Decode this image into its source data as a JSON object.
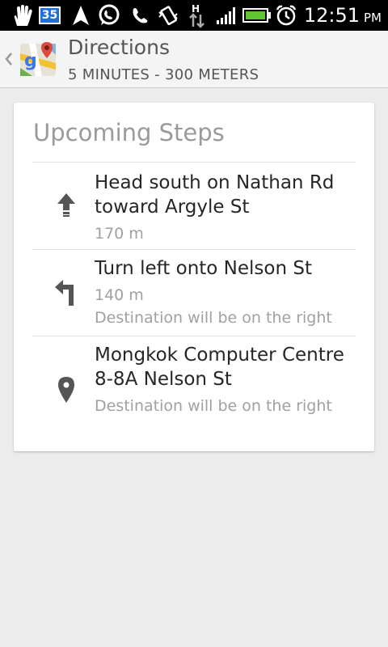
{
  "status_bar": {
    "notification_count": "35",
    "time": "12:51",
    "ampm": "PM",
    "network_type": "H",
    "icons": [
      "hand-icon",
      "notification-badge",
      "navigation-arrow-icon",
      "whatsapp-icon",
      "phone-missed-icon",
      "vibrate-icon",
      "data-arrows-icon",
      "signal-icon",
      "battery-icon",
      "alarm-icon"
    ]
  },
  "header": {
    "title": "Directions",
    "subtitle": "5 MINUTES - 300 METERS",
    "app_icon": "google-maps-icon"
  },
  "card": {
    "title": "Upcoming Steps",
    "steps": [
      {
        "icon": "arrow-up-icon",
        "instruction": "Head south on Nathan Rd toward Argyle St",
        "distance": "170 m",
        "note": ""
      },
      {
        "icon": "turn-left-icon",
        "instruction": "Turn left onto Nelson St",
        "distance": "140 m",
        "note": "Destination will be on the right"
      },
      {
        "icon": "location-pin-icon",
        "instruction": "Mongkok Computer Centre",
        "address": "8-8A Nelson St",
        "note": "Destination will be on the right"
      }
    ]
  },
  "colors": {
    "statusbar_bg": "#000000",
    "background": "#ececec",
    "card_bg": "#ffffff",
    "muted_text": "#a0a0a0"
  }
}
